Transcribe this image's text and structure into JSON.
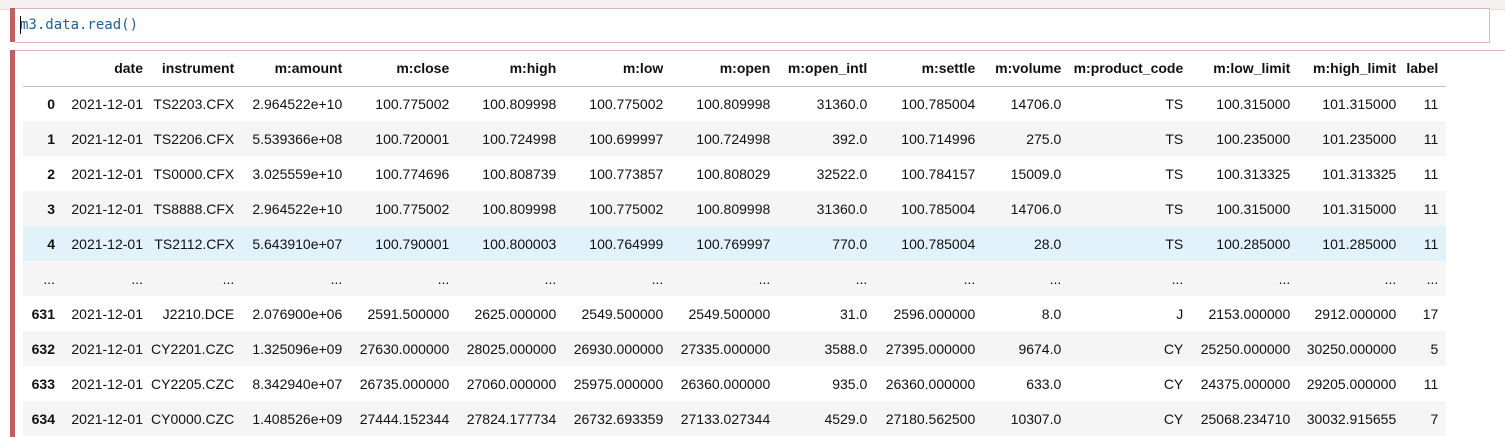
{
  "code_cell": {
    "source": "m3.data.read()"
  },
  "dataframe": {
    "columns": [
      "date",
      "instrument",
      "m:amount",
      "m:close",
      "m:high",
      "m:low",
      "m:open",
      "m:open_intl",
      "m:settle",
      "m:volume",
      "m:product_code",
      "m:low_limit",
      "m:high_limit",
      "label"
    ],
    "rows": [
      {
        "index": "0",
        "cells": [
          "2021-12-01",
          "TS2203.CFX",
          "2.964522e+10",
          "100.775002",
          "100.809998",
          "100.775002",
          "100.809998",
          "31360.0",
          "100.785004",
          "14706.0",
          "TS",
          "100.315000",
          "101.315000",
          "11"
        ]
      },
      {
        "index": "1",
        "cells": [
          "2021-12-01",
          "TS2206.CFX",
          "5.539366e+08",
          "100.720001",
          "100.724998",
          "100.699997",
          "100.724998",
          "392.0",
          "100.714996",
          "275.0",
          "TS",
          "100.235000",
          "101.235000",
          "11"
        ]
      },
      {
        "index": "2",
        "cells": [
          "2021-12-01",
          "TS0000.CFX",
          "3.025559e+10",
          "100.774696",
          "100.808739",
          "100.773857",
          "100.808029",
          "32522.0",
          "100.784157",
          "15009.0",
          "TS",
          "100.313325",
          "101.313325",
          "11"
        ]
      },
      {
        "index": "3",
        "cells": [
          "2021-12-01",
          "TS8888.CFX",
          "2.964522e+10",
          "100.775002",
          "100.809998",
          "100.775002",
          "100.809998",
          "31360.0",
          "100.785004",
          "14706.0",
          "TS",
          "100.315000",
          "101.315000",
          "11"
        ]
      },
      {
        "index": "4",
        "cells": [
          "2021-12-01",
          "TS2112.CFX",
          "5.643910e+07",
          "100.790001",
          "100.800003",
          "100.764999",
          "100.769997",
          "770.0",
          "100.785004",
          "28.0",
          "TS",
          "100.285000",
          "101.285000",
          "11"
        ]
      },
      {
        "index": "...",
        "cells": [
          "...",
          "...",
          "...",
          "...",
          "...",
          "...",
          "...",
          "...",
          "...",
          "...",
          "...",
          "...",
          "...",
          "..."
        ]
      },
      {
        "index": "631",
        "cells": [
          "2021-12-01",
          "J2210.DCE",
          "2.076900e+06",
          "2591.500000",
          "2625.000000",
          "2549.500000",
          "2549.500000",
          "31.0",
          "2596.000000",
          "8.0",
          "J",
          "2153.000000",
          "2912.000000",
          "17"
        ]
      },
      {
        "index": "632",
        "cells": [
          "2021-12-01",
          "CY2201.CZC",
          "1.325096e+09",
          "27630.000000",
          "28025.000000",
          "26930.000000",
          "27335.000000",
          "3588.0",
          "27395.000000",
          "9674.0",
          "CY",
          "25250.000000",
          "30250.000000",
          "5"
        ]
      },
      {
        "index": "633",
        "cells": [
          "2021-12-01",
          "CY2205.CZC",
          "8.342940e+07",
          "26735.000000",
          "27060.000000",
          "25975.000000",
          "26360.000000",
          "935.0",
          "26360.000000",
          "633.0",
          "CY",
          "24375.000000",
          "29205.000000",
          "11"
        ]
      },
      {
        "index": "634",
        "cells": [
          "2021-12-01",
          "CY0000.CZC",
          "1.408526e+09",
          "27444.152344",
          "27824.177734",
          "26732.693359",
          "27133.027344",
          "4529.0",
          "27180.562500",
          "10307.0",
          "CY",
          "25068.234710",
          "30032.915655",
          "7"
        ]
      }
    ]
  }
}
